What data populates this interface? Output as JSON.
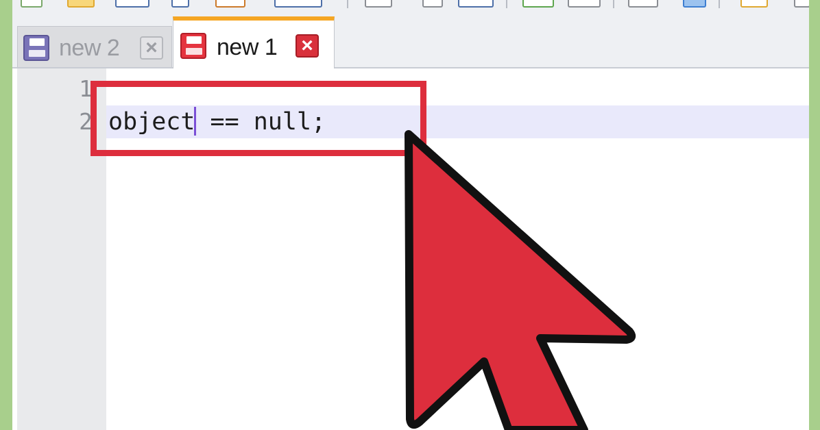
{
  "tabs": [
    {
      "label": "new 2",
      "active": false,
      "icon": "floppy-disk-icon"
    },
    {
      "label": "new 1",
      "active": true,
      "icon": "floppy-disk-icon"
    }
  ],
  "editor": {
    "line_numbers": [
      "1",
      "2"
    ],
    "lines": [
      "",
      "object == null;"
    ],
    "caret_line": 2,
    "code_before_caret": "object",
    "code_after_caret": " == null;"
  },
  "colors": {
    "annotation_red": "#dd2e3d",
    "active_tab_accent": "#f5a623",
    "frame_green": "#a8cf8c"
  }
}
